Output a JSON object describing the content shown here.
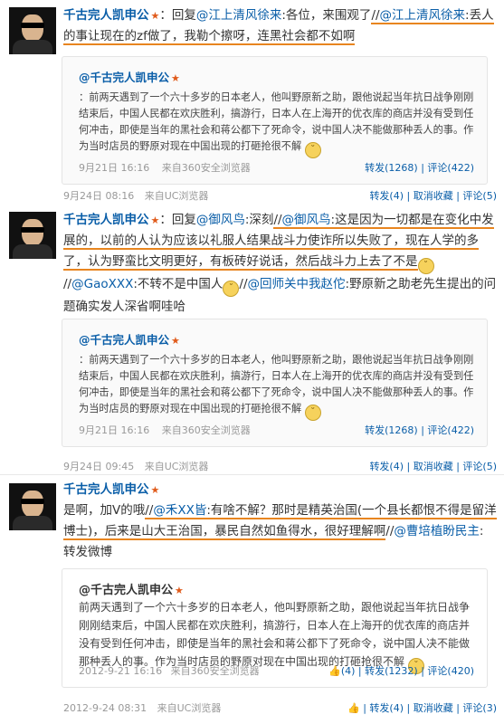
{
  "post1": {
    "author": "千古完人凯申公",
    "vip": "★",
    "reply_prefix": "：回复",
    "mention": "@江上清风徐来",
    "text_a": ":各位，来围观了",
    "repost_sep": "//",
    "repost_mention": "@江上清风徐来",
    "text_b": ":丢人的事让现在的zf做了，我勒个擦呀，连黑社会都不如啊",
    "quote": {
      "author": "@千古完人凯申公",
      "vip": "★",
      "text": "：前两天遇到了一个六十多岁的日本老人，他叫野原新之助，跟他说起当年抗日战争刚刚结束后，中国人民都在欢庆胜利，搞游行，日本人在上海开的优衣库的商店并没有受到任何冲击，即使是当年的黑社会和蒋公都下了死命令，说中国人决不能做那种丢人的事。作为当时店员的野原对现在中国出现的打砸抢很不解",
      "time": "9月21日 16:16",
      "source": "来自360安全浏览器",
      "actions": "转发(1268)  |  评论(422)"
    },
    "time": "9月24日 08:16",
    "source": "来自UC浏览器",
    "actions": "转发(4)  |  取消收藏  |  评论(5)"
  },
  "post2": {
    "author": "千古完人凯申公",
    "vip": "★",
    "reply_prefix": "：回复",
    "mention": "@御风鸟",
    "text_a": ":深刻",
    "repost_sep": "//",
    "repost_mention": "@御风鸟",
    "text_b": ":这是因为一切都是在变化中发展的，以前的人认为应该以礼服人结果战斗力使诈所以失败了，现在人学的多了，认为野蛮比文明更好，有板砖好说话，然后战斗力上去了不是",
    "mention2": "@GaoXXX",
    "text_c": ":不转不是中国人",
    "mention3": "@回师关中我赵佗",
    "text_d": ":野原新之助老先生提出的问题确实发人深省啊哇哈",
    "quote": {
      "author": "@千古完人凯申公",
      "vip": "★",
      "text": "：前两天遇到了一个六十多岁的日本老人，他叫野原新之助，跟他说起当年抗日战争刚刚结束后，中国人民都在欢庆胜利，搞游行，日本人在上海开的优衣库的商店并没有受到任何冲击，即使是当年的黑社会和蒋公都下了死命令，说中国人决不能做那种丢人的事。作为当时店员的野原对现在中国出现的打砸抢很不解",
      "time": "9月21日 16:16",
      "source": "来自360安全浏览器",
      "actions": "转发(1268)  |  评论(422)"
    },
    "time": "9月24日 09:45",
    "source": "来自UC浏览器",
    "actions": "转发(4)  |  取消收藏  |  评论(5)"
  },
  "post3": {
    "author": "千古完人凯申公",
    "vip": "★",
    "text_a": "是啊，加V的哦",
    "repost_sep": "//",
    "mention": "@禾XX皆",
    "text_b": ":有啥不解？那时是精英治国(一个县长都恨不得是留洋博士)，后来是山大王治国，暴民自然如鱼得水，很好理解啊",
    "mention2": "@曹培植盼民主",
    "text_c": ":",
    "text_d": "转发微博",
    "quote": {
      "author": "@千古完人凯申公",
      "vip": "★",
      "text": "前两天遇到了一个六十多岁的日本老人，他叫野原新之助，跟他说起当年抗日战争刚刚结束后，中国人民都在欢庆胜利，搞游行，日本人在上海开的优衣库的商店并没有受到任何冲击，即使是当年的黑社会和蒋公都下了死命令，说中国人决不能做那种丢人的事。作为当时店员的野原对现在中国出现的打砸抢很不解",
      "time": "2012-9-21 16:16",
      "source": "来自360安全浏览器",
      "actions": "👍(4)  |  转发(1232)  |  评论(420)"
    },
    "time": "2012-9-24 08:31",
    "source": "来自UC浏览器",
    "actions": "👍  |  转发(4)  |  取消收藏  |  评论(3)"
  },
  "icons": {
    "avatar": "avatar-icon",
    "smile": "smile-emoticon-icon"
  },
  "colors": {
    "link": "#0a5ea8",
    "underline": "#e8851f",
    "meta": "#999999"
  }
}
